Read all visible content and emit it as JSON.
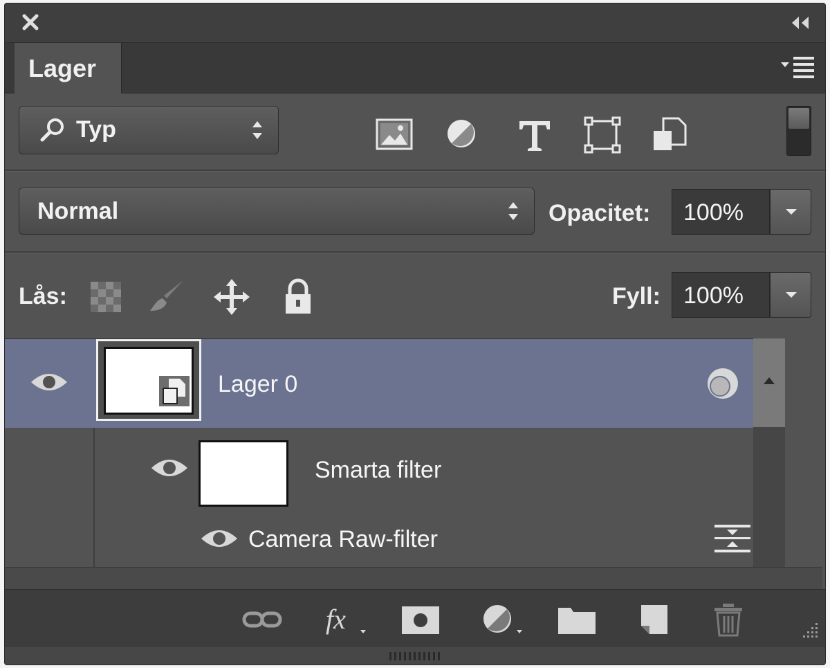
{
  "panel": {
    "tab_label": "Lager",
    "icons": [
      "close-icon",
      "collapse-icon",
      "panel-menu-icon"
    ]
  },
  "filter": {
    "kind_value": "Typ",
    "filter_icons": [
      "image-filter-icon",
      "adjustment-filter-icon",
      "type-filter-icon",
      "shape-filter-icon",
      "smart-object-filter-icon"
    ]
  },
  "blend": {
    "mode_value": "Normal",
    "opacity_label": "Opacitet:",
    "opacity_value": "100%"
  },
  "lock": {
    "label": "Lås:",
    "icons": [
      "lock-transparency-icon",
      "lock-image-icon",
      "lock-position-icon",
      "lock-all-icon"
    ],
    "fill_label": "Fyll:",
    "fill_value": "100%"
  },
  "layers": {
    "layer0_name": "Lager 0",
    "smart_filters_label": "Smarta filter",
    "camera_raw_label": "Camera Raw-filter"
  },
  "bottom_icons": [
    "link-layers-icon",
    "fx-icon",
    "layer-mask-icon",
    "adjustment-layer-icon",
    "new-group-icon",
    "new-layer-icon",
    "delete-icon"
  ]
}
